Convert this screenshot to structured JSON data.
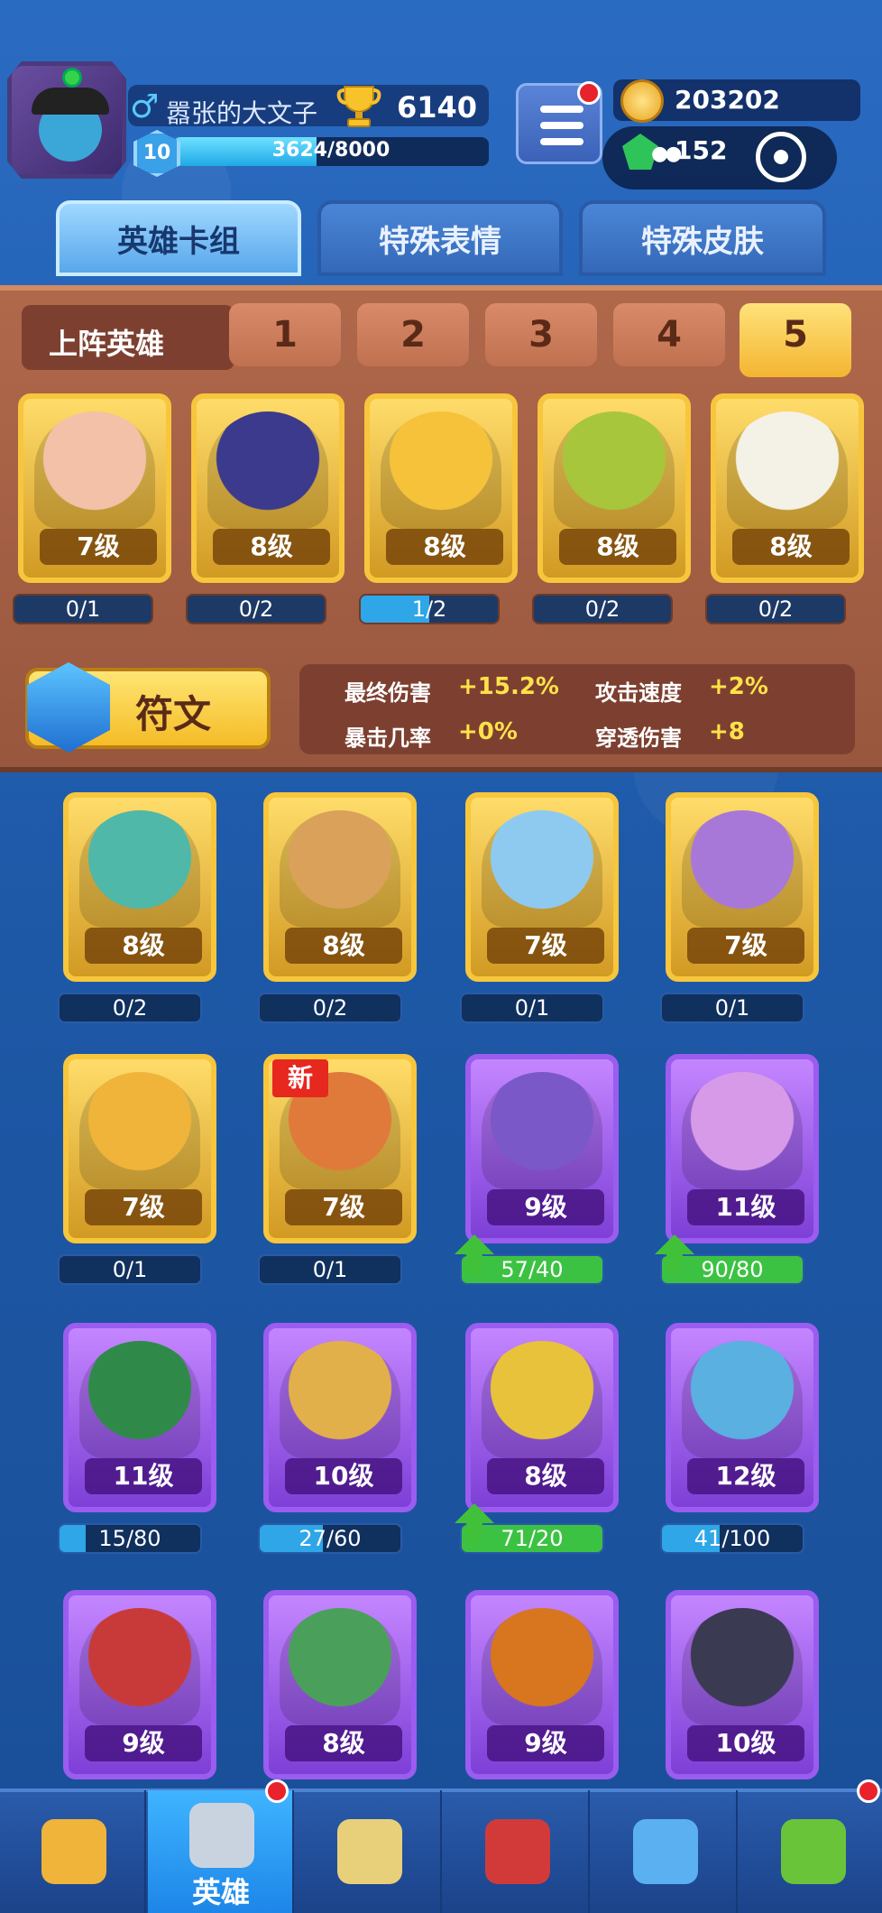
{
  "player": {
    "name": "嚣张的大文子",
    "trophies": "6140",
    "level": "10",
    "xp_text": "3624/8000",
    "xp_fraction": 0.453
  },
  "currency": {
    "coins": "203202",
    "gems": "152"
  },
  "tabs": [
    {
      "label": "英雄卡组",
      "active": true
    },
    {
      "label": "特殊表情",
      "active": false
    },
    {
      "label": "特殊皮肤",
      "active": false
    }
  ],
  "deck": {
    "title": "上阵英雄",
    "slots": [
      "1",
      "2",
      "3",
      "4",
      "5"
    ],
    "active_slot": "5",
    "cards": [
      {
        "level": "7级",
        "count": "0/1",
        "progress": 0,
        "color": "#f2c1a8"
      },
      {
        "level": "8级",
        "count": "0/2",
        "progress": 0,
        "color": "#3c3a8c"
      },
      {
        "level": "8级",
        "count": "1/2",
        "progress": 0.5,
        "color": "#f5c23a"
      },
      {
        "level": "8级",
        "count": "0/2",
        "progress": 0,
        "color": "#a8c63c"
      },
      {
        "level": "8级",
        "count": "0/2",
        "progress": 0,
        "color": "#f4f1e6"
      }
    ]
  },
  "rune": {
    "label": "符文",
    "stats": [
      {
        "name": "最终伤害",
        "value": "+15.2%"
      },
      {
        "name": "攻击速度",
        "value": "+2%"
      },
      {
        "name": "暴击几率",
        "value": "+0%"
      },
      {
        "name": "穿透伤害",
        "value": "+8"
      }
    ]
  },
  "collection": [
    {
      "level": "8级",
      "count": "0/2",
      "progress": 0,
      "rarity": "gold",
      "color": "#4fb8a8",
      "upgradable": false,
      "new": false
    },
    {
      "level": "8级",
      "count": "0/2",
      "progress": 0,
      "rarity": "gold",
      "color": "#d9a15a",
      "upgradable": false,
      "new": false
    },
    {
      "level": "7级",
      "count": "0/1",
      "progress": 0,
      "rarity": "gold",
      "color": "#8ecaf0",
      "upgradable": false,
      "new": false
    },
    {
      "level": "7级",
      "count": "0/1",
      "progress": 0,
      "rarity": "gold",
      "color": "#a878d8",
      "upgradable": false,
      "new": false
    },
    {
      "level": "7级",
      "count": "0/1",
      "progress": 0,
      "rarity": "gold",
      "color": "#f0b43a",
      "upgradable": false,
      "new": false
    },
    {
      "level": "7级",
      "count": "0/1",
      "progress": 0,
      "rarity": "gold",
      "color": "#e07a3a",
      "upgradable": false,
      "new": true,
      "badge": "新"
    },
    {
      "level": "9级",
      "count": "57/40",
      "progress": 1,
      "rarity": "purple",
      "color": "#7a58c8",
      "upgradable": true,
      "new": false
    },
    {
      "level": "11级",
      "count": "90/80",
      "progress": 1,
      "rarity": "purple",
      "color": "#d79ae8",
      "upgradable": true,
      "new": false
    },
    {
      "level": "11级",
      "count": "15/80",
      "progress": 0.1875,
      "rarity": "purple",
      "color": "#2f8a4a",
      "upgradable": false,
      "new": false
    },
    {
      "level": "10级",
      "count": "27/60",
      "progress": 0.45,
      "rarity": "purple",
      "color": "#e2b04a",
      "upgradable": false,
      "new": false
    },
    {
      "level": "8级",
      "count": "71/20",
      "progress": 1,
      "rarity": "purple",
      "color": "#e8c23a",
      "upgradable": true,
      "new": false
    },
    {
      "level": "12级",
      "count": "41/100",
      "progress": 0.41,
      "rarity": "purple",
      "color": "#5ab0e0",
      "upgradable": false,
      "new": false
    },
    {
      "level": "9级",
      "count": "",
      "progress": 0,
      "rarity": "purple",
      "color": "#c83a3a",
      "upgradable": false,
      "new": false
    },
    {
      "level": "8级",
      "count": "",
      "progress": 0,
      "rarity": "purple",
      "color": "#4aa05a",
      "upgradable": false,
      "new": false
    },
    {
      "level": "9级",
      "count": "",
      "progress": 0,
      "rarity": "purple",
      "color": "#d8761f",
      "upgradable": false,
      "new": false
    },
    {
      "level": "10级",
      "count": "",
      "progress": 0,
      "rarity": "purple",
      "color": "#3a3a52",
      "upgradable": false,
      "new": false
    }
  ],
  "nav": [
    {
      "icon": "treasure-chest-icon",
      "label": "",
      "active": false,
      "dot": false
    },
    {
      "icon": "knight-helmet-icon",
      "label": "英雄",
      "active": true,
      "dot": true
    },
    {
      "icon": "crossed-swords-icon",
      "label": "",
      "active": false,
      "dot": false
    },
    {
      "icon": "crown-shield-icon",
      "label": "",
      "active": false,
      "dot": false
    },
    {
      "icon": "guild-banner-icon",
      "label": "",
      "active": false,
      "dot": false
    },
    {
      "icon": "sprout-icon",
      "label": "",
      "active": false,
      "dot": true
    }
  ]
}
